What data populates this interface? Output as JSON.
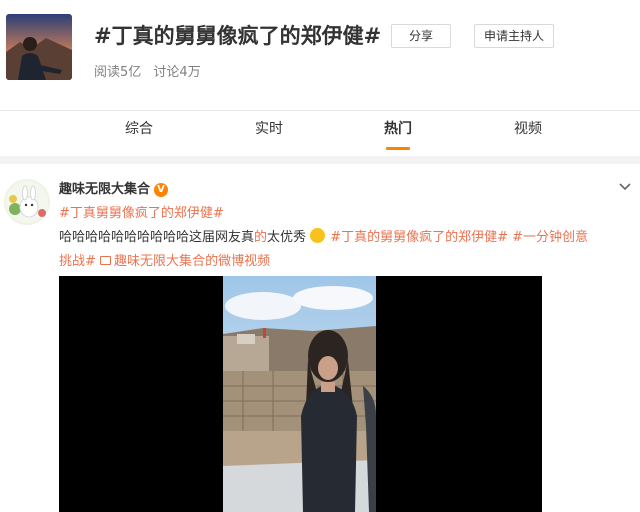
{
  "topic": {
    "title": "#丁真的舅舅像疯了的郑伊健#",
    "reads": "阅读5亿",
    "discussions": "讨论4万",
    "share_label": "分享",
    "host_label": "申请主持人"
  },
  "tabs": [
    {
      "label": "综合",
      "active": false
    },
    {
      "label": "实时",
      "active": false
    },
    {
      "label": "热门",
      "active": true
    },
    {
      "label": "视频",
      "active": false
    }
  ],
  "post": {
    "author": "趣味无限大集合",
    "verified_badge": "V",
    "tag": "#丁真舅舅像疯了的郑伊健#",
    "text_a": "哈哈哈哈哈哈哈哈哈哈这届网友真",
    "text_b": "的",
    "text_c": "太优秀",
    "tag2": "#丁真的舅舅像疯了的郑伊健#",
    "tag3_line1": "#一分钟创意",
    "tag3_line2": "挑战#",
    "video_source": "趣味无限大集合",
    "video_source_suffix_a": "的",
    "video_source_suffix_b": "微博视频"
  },
  "icons": {
    "emoji": "laughing-emoji-icon",
    "video": "video-link-icon",
    "chevron": "chevron-down-icon"
  },
  "colors": {
    "accent": "#ff8200",
    "link": "#eb7350"
  }
}
